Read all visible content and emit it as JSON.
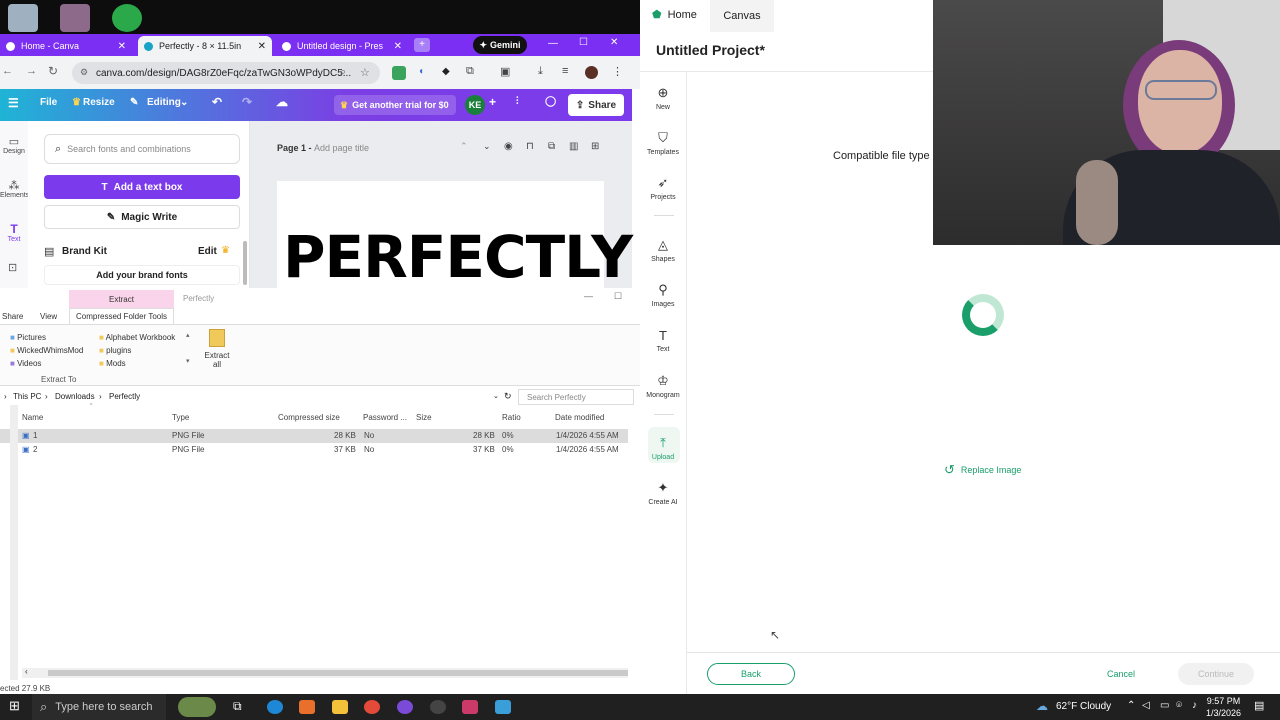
{
  "browser": {
    "tabs": [
      {
        "label": "Home - Canva",
        "active": false
      },
      {
        "label": "Perfectly - 8 × 11.5in",
        "active": true
      },
      {
        "label": "Untitled design - Present",
        "active": false
      }
    ],
    "gemini_label": "Gemini",
    "url": "canva.com/design/DAG8rZ0eFqc/zaTwGN3oWPdyDC5..."
  },
  "canva": {
    "menu": {
      "file": "File",
      "resize": "Resize",
      "editing": "Editing"
    },
    "trial": "Get another trial for $0",
    "avatar": "KE",
    "share": "Share",
    "sidebar": [
      "Design",
      "Elements",
      "Text"
    ],
    "search_placeholder": "Search fonts and combinations",
    "add_text_box": "Add a text box",
    "magic_write": "Magic Write",
    "brand_kit": "Brand Kit",
    "brand_edit": "Edit",
    "add_brand_fonts": "Add your brand fonts",
    "page_label": "Page 1 - ",
    "page_title_placeholder": "Add page title",
    "design_text": "PERFECTLY"
  },
  "explorer": {
    "ribbon_group": "Extract",
    "window_title": "Perfectly",
    "tabs": [
      "Share",
      "View",
      "Compressed Folder Tools"
    ],
    "quick_col1": [
      "Pictures",
      "WickedWhimsMod",
      "Videos"
    ],
    "quick_col2": [
      "Alphabet Workbook",
      "plugins",
      "Mods"
    ],
    "extract_all": "Extract all",
    "extract_to": "Extract To",
    "breadcrumb": [
      "This PC",
      "Downloads",
      "Perfectly"
    ],
    "search_placeholder": "Search Perfectly",
    "columns": [
      "Name",
      "Type",
      "Compressed size",
      "Password ...",
      "Size",
      "Ratio",
      "Date modified"
    ],
    "rows": [
      {
        "name": "1",
        "type": "PNG File",
        "compressed": "28 KB",
        "password": "No",
        "size": "28 KB",
        "ratio": "0%",
        "date": "1/4/2026 4:55 AM"
      },
      {
        "name": "2",
        "type": "PNG File",
        "compressed": "37 KB",
        "password": "No",
        "size": "37 KB",
        "ratio": "0%",
        "date": "1/4/2026 4:55 AM"
      }
    ],
    "status": "ected 27.9 KB"
  },
  "right_app": {
    "tabs": [
      "Home",
      "Canvas"
    ],
    "project_title": "Untitled Project*",
    "nav": [
      "New",
      "Templates",
      "Projects",
      "Shapes",
      "Images",
      "Text",
      "Monogram",
      "Upload",
      "Create AI"
    ],
    "compatible": "Compatible file type",
    "replace_image": "Replace Image",
    "back": "Back",
    "cancel": "Cancel",
    "continue": "Continue",
    "accent": "#1a9e6a"
  },
  "taskbar": {
    "search_placeholder": "Type here to search",
    "weather": "62°F  Cloudy",
    "time": "9:57 PM",
    "date": "1/3/2026"
  }
}
